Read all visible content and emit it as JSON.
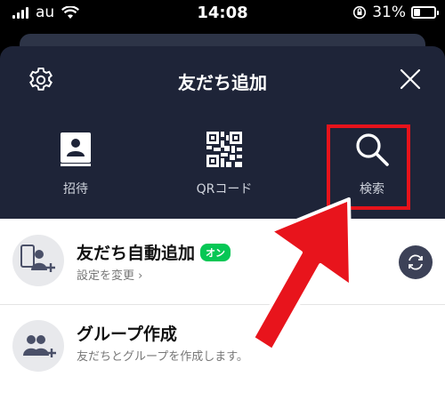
{
  "status_bar": {
    "carrier": "au",
    "time": "14:08",
    "battery": "31%",
    "battery_level": 0.31
  },
  "header": {
    "title": "友だち追加",
    "settings_icon": "gear-icon",
    "close_icon": "close-icon"
  },
  "actions": [
    {
      "label": "招待",
      "icon": "contact-book-icon"
    },
    {
      "label": "QRコード",
      "icon": "qr-code-icon"
    },
    {
      "label": "検索",
      "icon": "search-icon"
    }
  ],
  "list": {
    "auto_add": {
      "title": "友だち自動追加",
      "badge": "オン",
      "subtitle": "設定を変更 ›"
    },
    "group": {
      "title": "グループ作成",
      "subtitle": "友だちとグループを作成します。"
    }
  },
  "colors": {
    "header_bg": "#1e2438",
    "highlight": "#e6131b",
    "badge": "#06c755",
    "arrow": "#e8141c"
  }
}
